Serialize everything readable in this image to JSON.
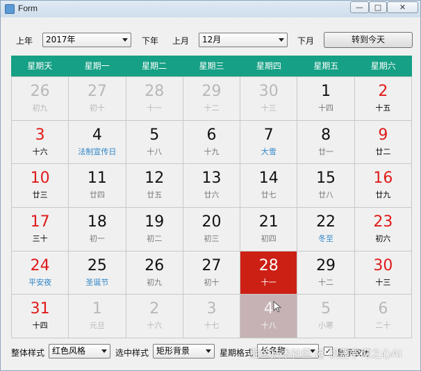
{
  "window": {
    "title": "Form",
    "min": "—",
    "max": "□",
    "close": "✕"
  },
  "toolbar": {
    "prev_year": "上年",
    "year": "2017年",
    "next_year": "下年",
    "prev_month": "上月",
    "month": "12月",
    "next_month": "下月",
    "today": "转到今天"
  },
  "weekdays": [
    "星期天",
    "星期一",
    "星期二",
    "星期三",
    "星期四",
    "星期五",
    "星期六"
  ],
  "days": [
    {
      "d": "26",
      "l": "初九",
      "t": "other"
    },
    {
      "d": "27",
      "l": "初十",
      "t": "other"
    },
    {
      "d": "28",
      "l": "十一",
      "t": "other"
    },
    {
      "d": "29",
      "l": "十二",
      "t": "other"
    },
    {
      "d": "30",
      "l": "十三",
      "t": "other"
    },
    {
      "d": "1",
      "l": "十四",
      "t": "cur"
    },
    {
      "d": "2",
      "l": "十五",
      "t": "wk"
    },
    {
      "d": "3",
      "l": "十六",
      "t": "wk"
    },
    {
      "d": "4",
      "l": "法制宣传日",
      "t": "cur",
      "f": true
    },
    {
      "d": "5",
      "l": "十八",
      "t": "cur"
    },
    {
      "d": "6",
      "l": "十九",
      "t": "cur"
    },
    {
      "d": "7",
      "l": "大雪",
      "t": "cur",
      "f": true
    },
    {
      "d": "8",
      "l": "廿一",
      "t": "cur"
    },
    {
      "d": "9",
      "l": "廿二",
      "t": "wk"
    },
    {
      "d": "10",
      "l": "廿三",
      "t": "wk"
    },
    {
      "d": "11",
      "l": "廿四",
      "t": "cur"
    },
    {
      "d": "12",
      "l": "廿五",
      "t": "cur"
    },
    {
      "d": "13",
      "l": "廿六",
      "t": "cur"
    },
    {
      "d": "14",
      "l": "廿七",
      "t": "cur"
    },
    {
      "d": "15",
      "l": "廿八",
      "t": "cur"
    },
    {
      "d": "16",
      "l": "廿九",
      "t": "wk"
    },
    {
      "d": "17",
      "l": "三十",
      "t": "wk"
    },
    {
      "d": "18",
      "l": "初一",
      "t": "cur"
    },
    {
      "d": "19",
      "l": "初二",
      "t": "cur"
    },
    {
      "d": "20",
      "l": "初三",
      "t": "cur"
    },
    {
      "d": "21",
      "l": "初四",
      "t": "cur"
    },
    {
      "d": "22",
      "l": "冬至",
      "t": "cur",
      "f": true
    },
    {
      "d": "23",
      "l": "初六",
      "t": "wk"
    },
    {
      "d": "24",
      "l": "平安夜",
      "t": "wk",
      "f": true
    },
    {
      "d": "25",
      "l": "圣诞节",
      "t": "cur",
      "f": true
    },
    {
      "d": "26",
      "l": "初九",
      "t": "cur"
    },
    {
      "d": "27",
      "l": "初十",
      "t": "cur"
    },
    {
      "d": "28",
      "l": "十一",
      "t": "sel"
    },
    {
      "d": "29",
      "l": "十二",
      "t": "cur"
    },
    {
      "d": "30",
      "l": "十三",
      "t": "wk"
    },
    {
      "d": "31",
      "l": "十四",
      "t": "wk"
    },
    {
      "d": "1",
      "l": "元旦",
      "t": "other"
    },
    {
      "d": "2",
      "l": "十六",
      "t": "other"
    },
    {
      "d": "3",
      "l": "十七",
      "t": "other"
    },
    {
      "d": "4",
      "l": "十八",
      "t": "hover"
    },
    {
      "d": "5",
      "l": "小寒",
      "t": "other"
    },
    {
      "d": "6",
      "l": "二十",
      "t": "other"
    }
  ],
  "footer": {
    "style_label": "整体样式",
    "style_value": "红色风格",
    "select_label": "选中样式",
    "select_value": "矩形背景",
    "week_label": "星期格式",
    "week_value": "长名称",
    "lunar_label": "显示农历",
    "lunar_checked": "✓"
  },
  "watermark": "掘金技术社区 @ 机器学习之心AI",
  "colors": {
    "header": "#16a085",
    "selected": "#cc2015",
    "weekend": "#e01a1a",
    "festival": "#2e86c8"
  }
}
